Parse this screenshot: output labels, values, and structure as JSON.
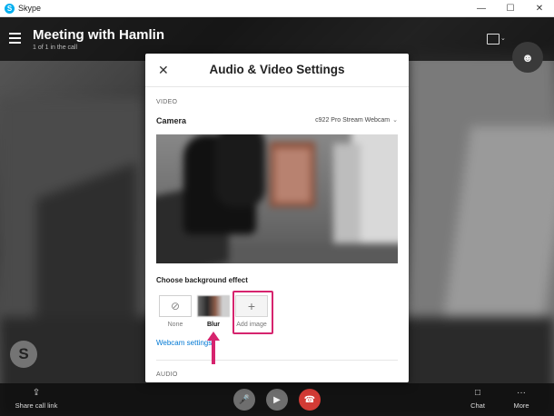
{
  "window": {
    "app_title": "Skype",
    "minimize": "—",
    "maximize": "☐",
    "close": "✕"
  },
  "call": {
    "title": "Meeting with Hamlin",
    "subtitle": "1 of 1 in the call",
    "skype_badge": "S",
    "share_link": "Share call link",
    "chat": "Chat",
    "more": "More"
  },
  "dialog": {
    "title": "Audio & Video Settings",
    "video_section": "VIDEO",
    "camera_label": "Camera",
    "camera_value": "c922 Pro Stream Webcam",
    "background_label": "Choose background effect",
    "effects": [
      {
        "label": "None",
        "icon": "⊘"
      },
      {
        "label": "Blur",
        "icon": ""
      },
      {
        "label": "Add image",
        "icon": "+"
      }
    ],
    "webcam_settings": "Webcam settings",
    "audio_section": "AUDIO"
  },
  "colors": {
    "accent": "#0078d4",
    "highlight": "#d6246e",
    "end_call": "#d23b35"
  }
}
